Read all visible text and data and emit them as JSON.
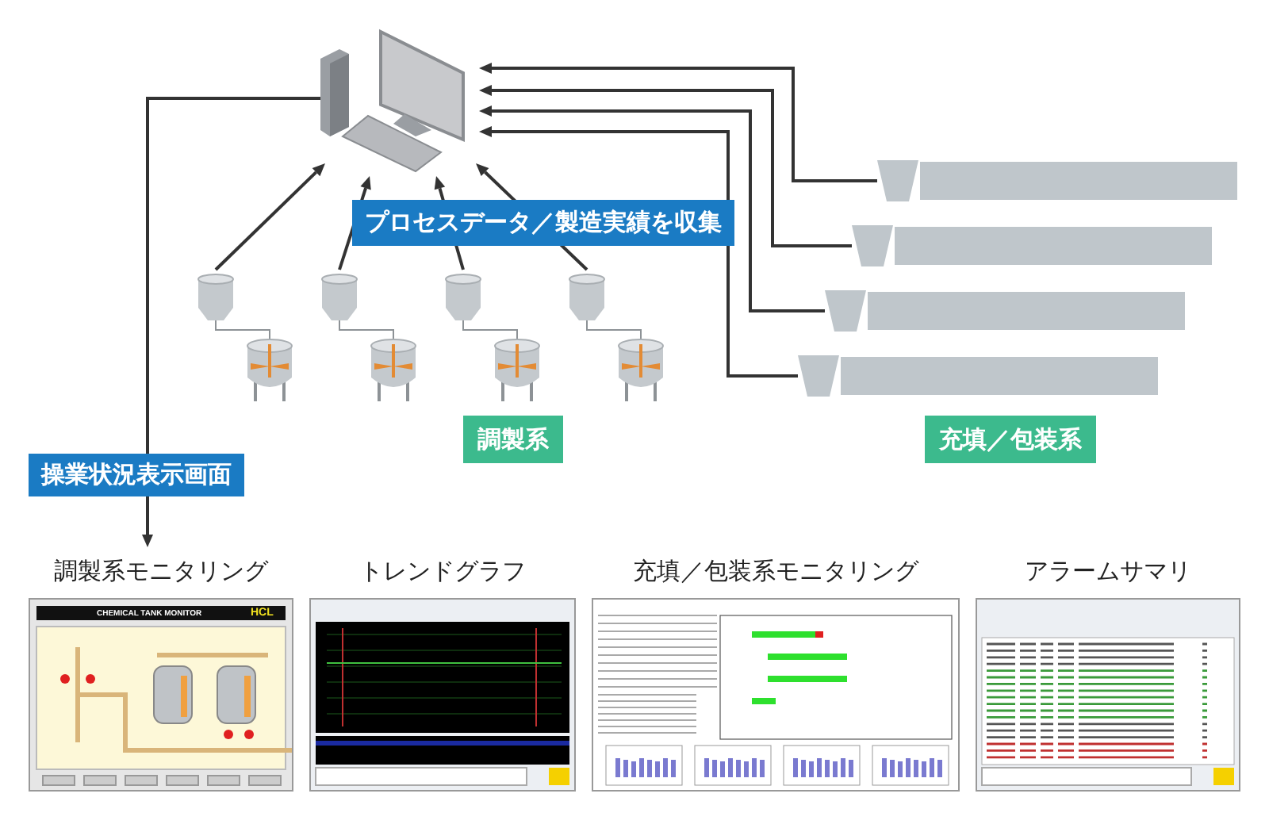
{
  "collect_label": "プロセスデータ／製造実績を収集",
  "display_label": "操業状況表示画面",
  "groups": [
    {
      "label": "調製系",
      "kind": "prep"
    },
    {
      "label": "充填／包装系",
      "kind": "fill"
    }
  ],
  "screens": [
    {
      "title": "調製系モニタリング",
      "kind": "monitor",
      "header": "CHEMICAL TANK MONITOR",
      "tag": "HCL"
    },
    {
      "title": "トレンドグラフ",
      "kind": "trend"
    },
    {
      "title": "充填／包装系モニタリング",
      "kind": "report"
    },
    {
      "title": "アラームサマリ",
      "kind": "alarm"
    }
  ]
}
